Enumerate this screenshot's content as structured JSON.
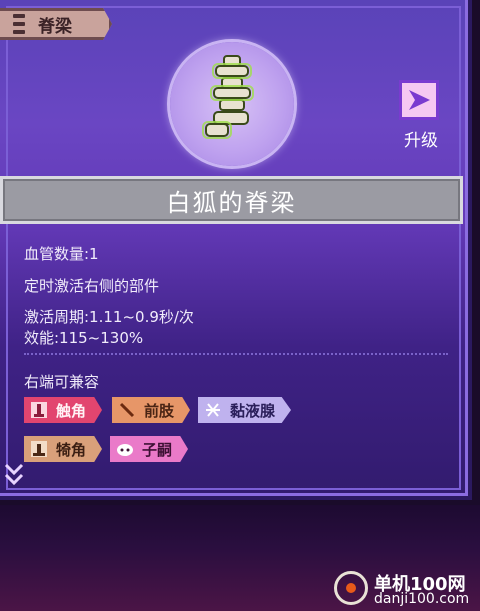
{
  "header": {
    "tab_label": "脊梁"
  },
  "item": {
    "name": "白狐的脊梁",
    "upgrade_label": "升级"
  },
  "stats": {
    "blood_vessels": "血管数量:1",
    "trigger": "定时激活右侧的部件",
    "period": "激活周期:1.11~0.9秒/次",
    "efficacy": "效能:115~130%"
  },
  "compat": {
    "heading": "右端可兼容",
    "tags": [
      {
        "label": "触角",
        "icon": "tentacle-icon",
        "color": "#e2456f"
      },
      {
        "label": "前肢",
        "icon": "forelimb-icon",
        "color": "#e79668"
      },
      {
        "label": "黏液腺",
        "icon": "mucus-gland-icon",
        "color": "#bfb2ee"
      },
      {
        "label": "犄角",
        "icon": "horn-icon",
        "color": "#d9a07a"
      },
      {
        "label": "子嗣",
        "icon": "offspring-icon",
        "color": "#ea7ac9"
      }
    ]
  },
  "watermark": {
    "line1": "单机100网",
    "line2": "danji100.com"
  },
  "colors": {
    "panel_bg": "#6339b7",
    "name_bar": "#9b9ba3",
    "tab": "#c9a39c",
    "upgrade_btn": "#f6c8f2"
  }
}
